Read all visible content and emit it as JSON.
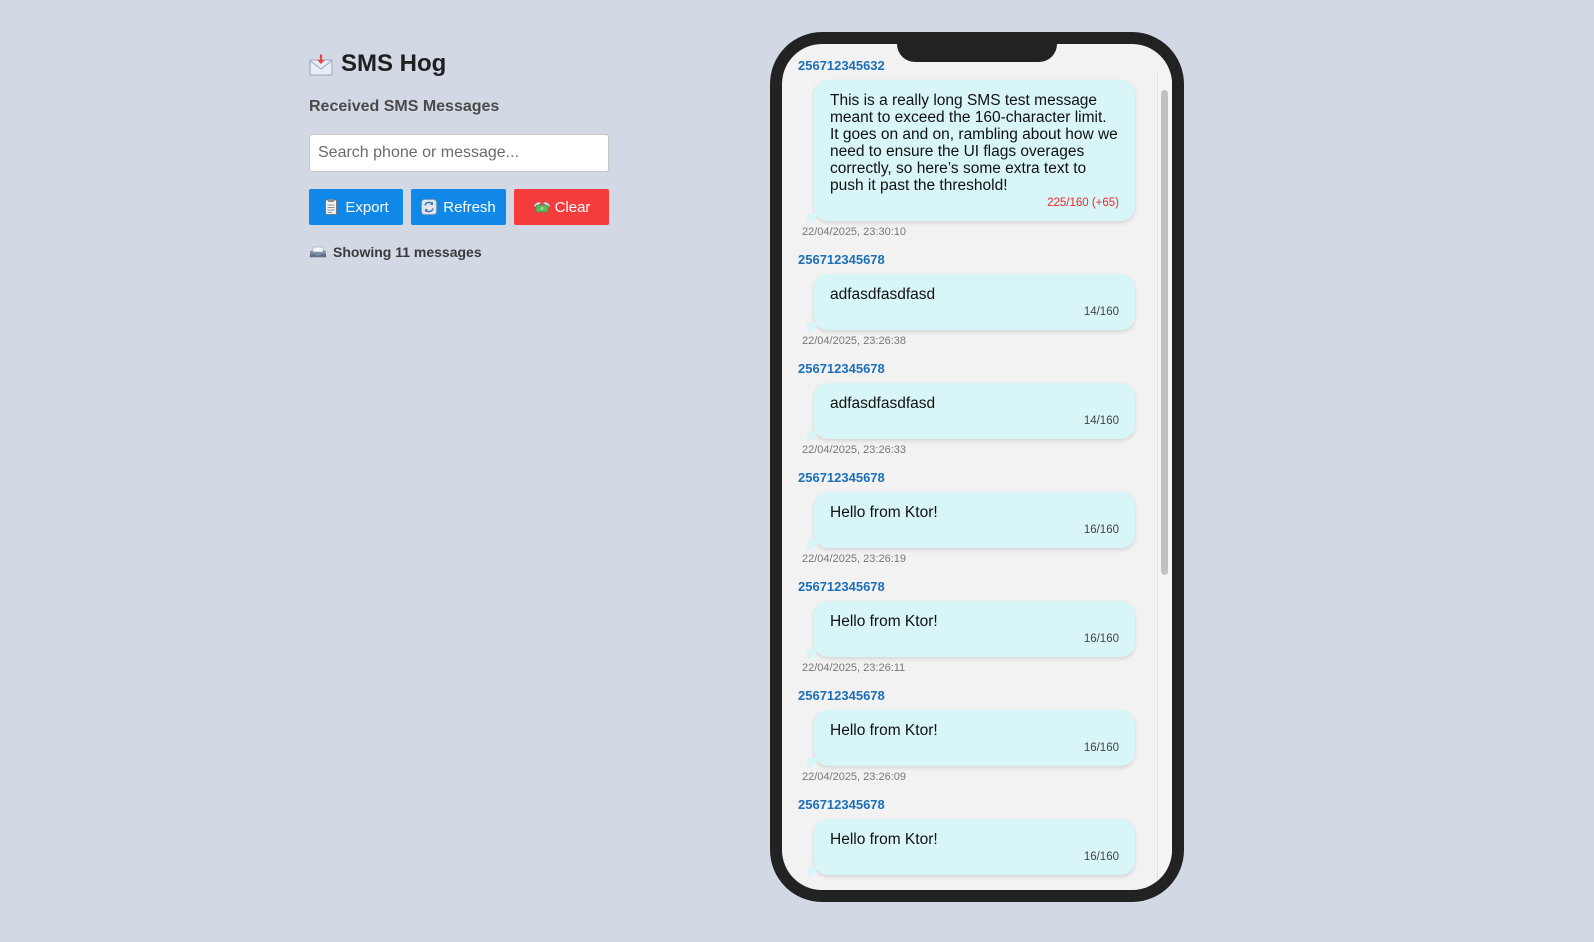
{
  "app": {
    "title": "SMS Hog",
    "subtitle": "Received SMS Messages"
  },
  "search": {
    "placeholder": "Search phone or message...",
    "value": ""
  },
  "toolbar": {
    "export_label": "Export",
    "refresh_label": "Refresh",
    "clear_label": "Clear"
  },
  "status": {
    "count_text": "Showing 11 messages"
  },
  "colors": {
    "primary": "#0f88e8",
    "danger": "#f43c3c",
    "bubble": "#d8f5f7",
    "sender": "#1c6fb8",
    "over_limit": "#ee2a2a"
  },
  "messages": [
    {
      "sender": "256712345632",
      "text": "This is a really long SMS test message meant to exceed the 160-character limit. It goes on and on, rambling about how we need to ensure the UI flags overages correctly, so here’s some extra text to push it past the threshold!",
      "count": "225/160 (+65)",
      "over": true,
      "time": "22/04/2025, 23:30:10"
    },
    {
      "sender": "256712345678",
      "text": "adfasdfasdfasd",
      "count": "14/160",
      "over": false,
      "time": "22/04/2025, 23:26:38"
    },
    {
      "sender": "256712345678",
      "text": "adfasdfasdfasd",
      "count": "14/160",
      "over": false,
      "time": "22/04/2025, 23:26:33"
    },
    {
      "sender": "256712345678",
      "text": "Hello from Ktor!",
      "count": "16/160",
      "over": false,
      "time": "22/04/2025, 23:26:19"
    },
    {
      "sender": "256712345678",
      "text": "Hello from Ktor!",
      "count": "16/160",
      "over": false,
      "time": "22/04/2025, 23:26:11"
    },
    {
      "sender": "256712345678",
      "text": "Hello from Ktor!",
      "count": "16/160",
      "over": false,
      "time": "22/04/2025, 23:26:09"
    },
    {
      "sender": "256712345678",
      "text": "Hello from Ktor!",
      "count": "16/160",
      "over": false,
      "time": ""
    }
  ]
}
